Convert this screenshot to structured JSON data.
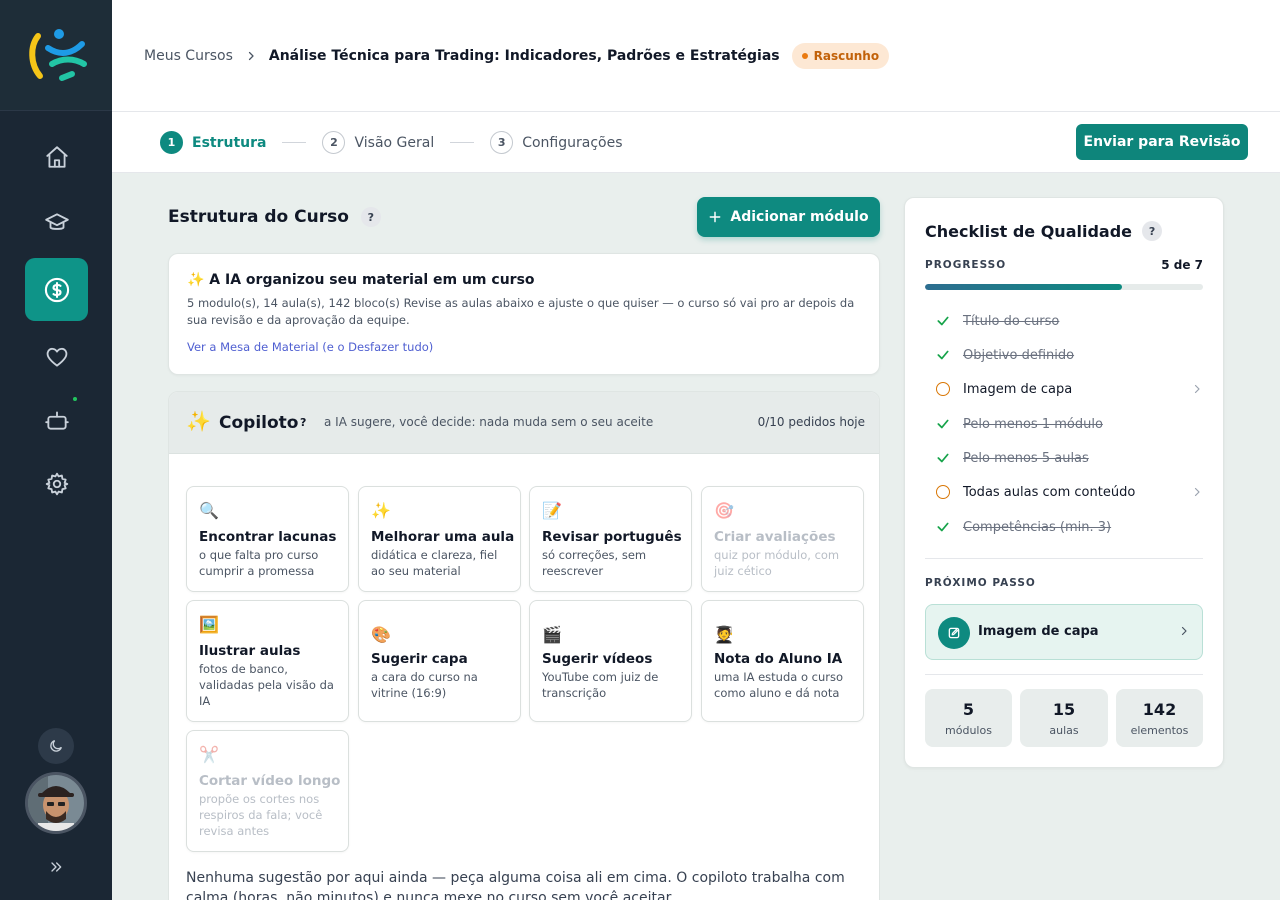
{
  "breadcrumb": {
    "root": "Meus Cursos",
    "current": "Análise Técnica para Trading: Indicadores, Padrões e Estratégias",
    "status": "Rascunho"
  },
  "steps": [
    {
      "num": "1",
      "label": "Estrutura"
    },
    {
      "num": "2",
      "label": "Visão Geral"
    },
    {
      "num": "3",
      "label": "Configurações"
    }
  ],
  "submit_label": "Enviar para Revisão",
  "main": {
    "title": "Estrutura do Curso",
    "help": "?",
    "add_module": "Adicionar módulo"
  },
  "ia_card": {
    "title": "✨ A IA organizou seu material em um curso",
    "body": "5 modulo(s), 14 aula(s), 142 bloco(s) Revise as aulas abaixo e ajuste o que quiser — o curso só vai pro ar depois da sua revisão e da aprovação da equipe.",
    "link": "Ver a Mesa de Material (e o Desfazer tudo)"
  },
  "copilot": {
    "icon": "✨",
    "title": "Copiloto",
    "help": "?",
    "subtitle": "a IA sugere, você decide: nada muda sem o seu aceite",
    "count": "0/10 pedidos hoje",
    "tiles": [
      {
        "icon": "🔍",
        "title": "Encontrar lacunas",
        "desc": "o que falta pro curso cumprir a promessa"
      },
      {
        "icon": "✨",
        "title": "Melhorar uma aula",
        "desc": "didática e clareza, fiel ao seu material"
      },
      {
        "icon": "📝",
        "title": "Revisar português",
        "desc": "só correções, sem reescrever"
      },
      {
        "icon": "🎯",
        "title": "Criar avaliações",
        "desc": "quiz por módulo, com juiz cético"
      },
      {
        "icon": "🖼️",
        "title": "Ilustrar aulas",
        "desc": "fotos de banco, validadas pela visão da IA"
      },
      {
        "icon": "🎨",
        "title": "Sugerir capa",
        "desc": "a cara do curso na vitrine (16:9)"
      },
      {
        "icon": "🎬",
        "title": "Sugerir vídeos",
        "desc": "YouTube com juiz de transcrição"
      },
      {
        "icon": "🧑‍🎓",
        "title": "Nota do Aluno IA",
        "desc": "uma IA estuda o curso como aluno e dá nota"
      },
      {
        "icon": "✂️",
        "title": "Cortar vídeo longo",
        "desc": "propõe os cortes nos respiros da fala; você revisa antes"
      }
    ],
    "empty": "Nenhuma sugestão por aqui ainda — peça alguma coisa ali em cima. O copiloto trabalha com calma (horas, não minutos) e nunca mexe no curso sem você aceitar."
  },
  "checklist": {
    "title": "Checklist de Qualidade",
    "help": "?",
    "progress_label": "PROGRESSO",
    "progress_value": "5 de 7",
    "progress_fraction": 0.71,
    "items": [
      {
        "label": "Título do curso",
        "done": true
      },
      {
        "label": "Objetivo definido",
        "done": true
      },
      {
        "label": "Imagem de capa",
        "done": false
      },
      {
        "label": "Pelo menos 1 módulo",
        "done": true
      },
      {
        "label": "Pelo menos 5 aulas",
        "done": true
      },
      {
        "label": "Todas aulas com conteúdo",
        "done": false
      },
      {
        "label": "Competências (min. 3)",
        "done": true
      }
    ],
    "next_label": "PRÓXIMO PASSO",
    "next_step": "Imagem de capa",
    "stats": [
      {
        "value": "5",
        "caption": "módulos"
      },
      {
        "value": "15",
        "caption": "aulas"
      },
      {
        "value": "142",
        "caption": "elementos"
      }
    ]
  },
  "colors": {
    "accent": "#0e8a80",
    "sidebar": "#1b2734",
    "draft_badge": "#fde8d4",
    "pending": "#d97706",
    "done": "#16a34a"
  },
  "icons": {
    "sidebar": [
      "home-icon",
      "graduation-cap-icon",
      "dollar-icon",
      "heart-icon",
      "robot-icon",
      "gear-icon"
    ],
    "theme": "moon-icon",
    "expand": "double-chevron-right-icon"
  }
}
